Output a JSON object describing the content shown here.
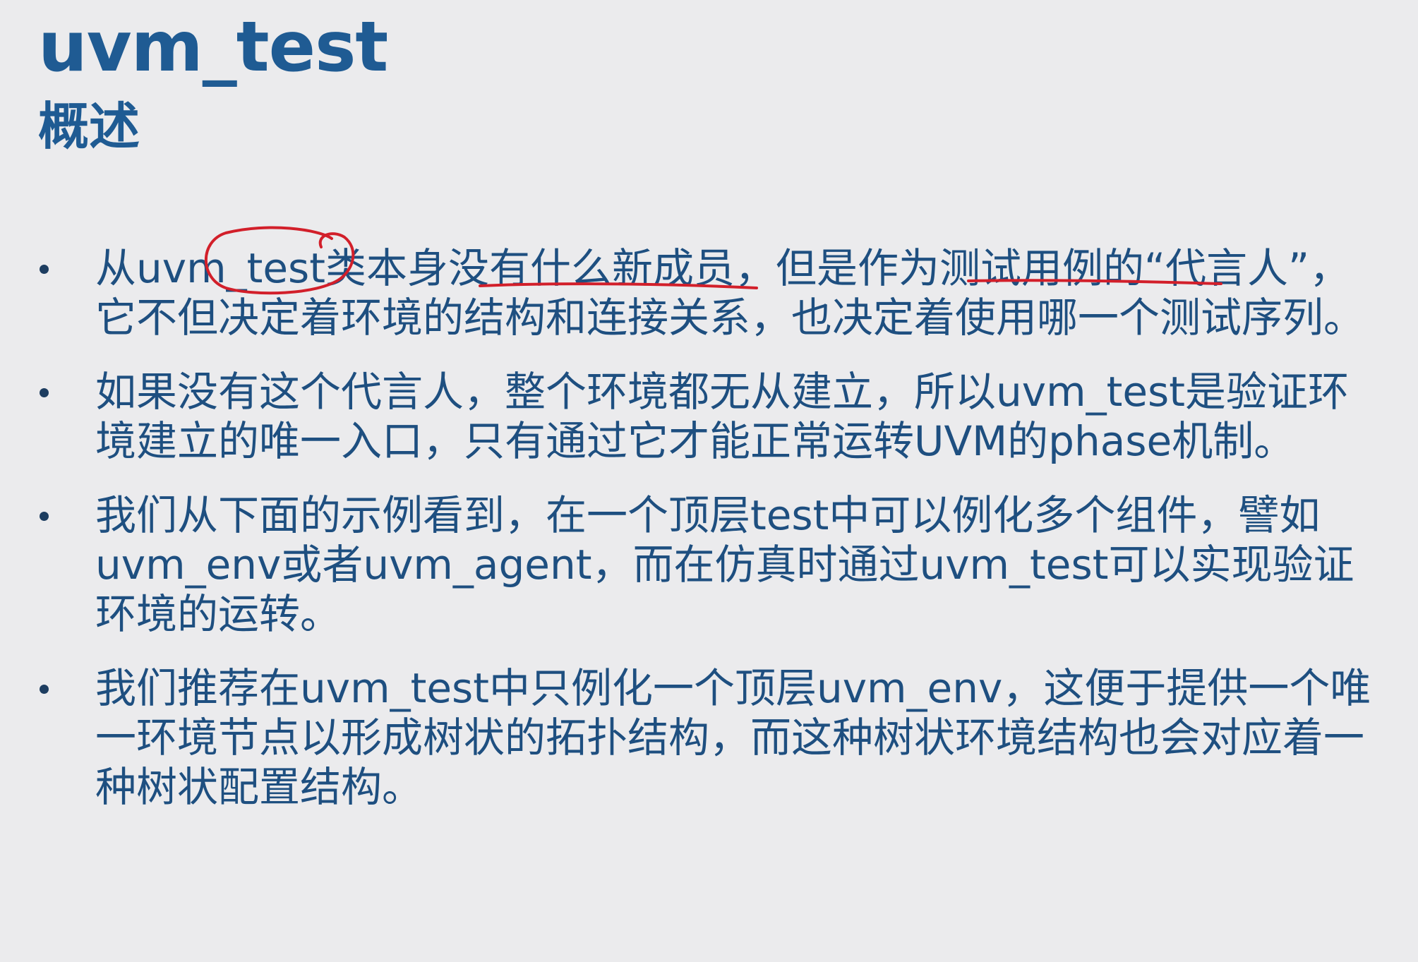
{
  "slide": {
    "title": "uvm_test",
    "subtitle": "概述",
    "bullets": [
      {
        "text": "从uvm_test类本身没有什么新成员，但是作为测试用例的“代言人”，它不但决定着环境的结构和连接关系，也决定着使用哪一个测试序列。"
      },
      {
        "text": "如果没有这个代言人，整个环境都无从建立，所以uvm_test是验证环境建立的唯一入口，只有通过它才能正常运转UVM的phase机制。"
      },
      {
        "text": "我们从下面的示例看到，在一个顶层test中可以例化多个组件，譬如uvm_env或者uvm_agent，而在仿真时通过uvm_test可以实现验证环境的运转。"
      },
      {
        "text": "我们推荐在uvm_test中只例化一个顶层uvm_env，这便于提供一个唯一环境节点以形成树状的拓扑结构，而这种树状环境结构也会对应着一种树状配置结构。"
      }
    ]
  },
  "colors": {
    "background": "#ebebed",
    "title": "#1f5b93",
    "body_text": "#1e4f80",
    "annotation": "#d21f2a"
  }
}
